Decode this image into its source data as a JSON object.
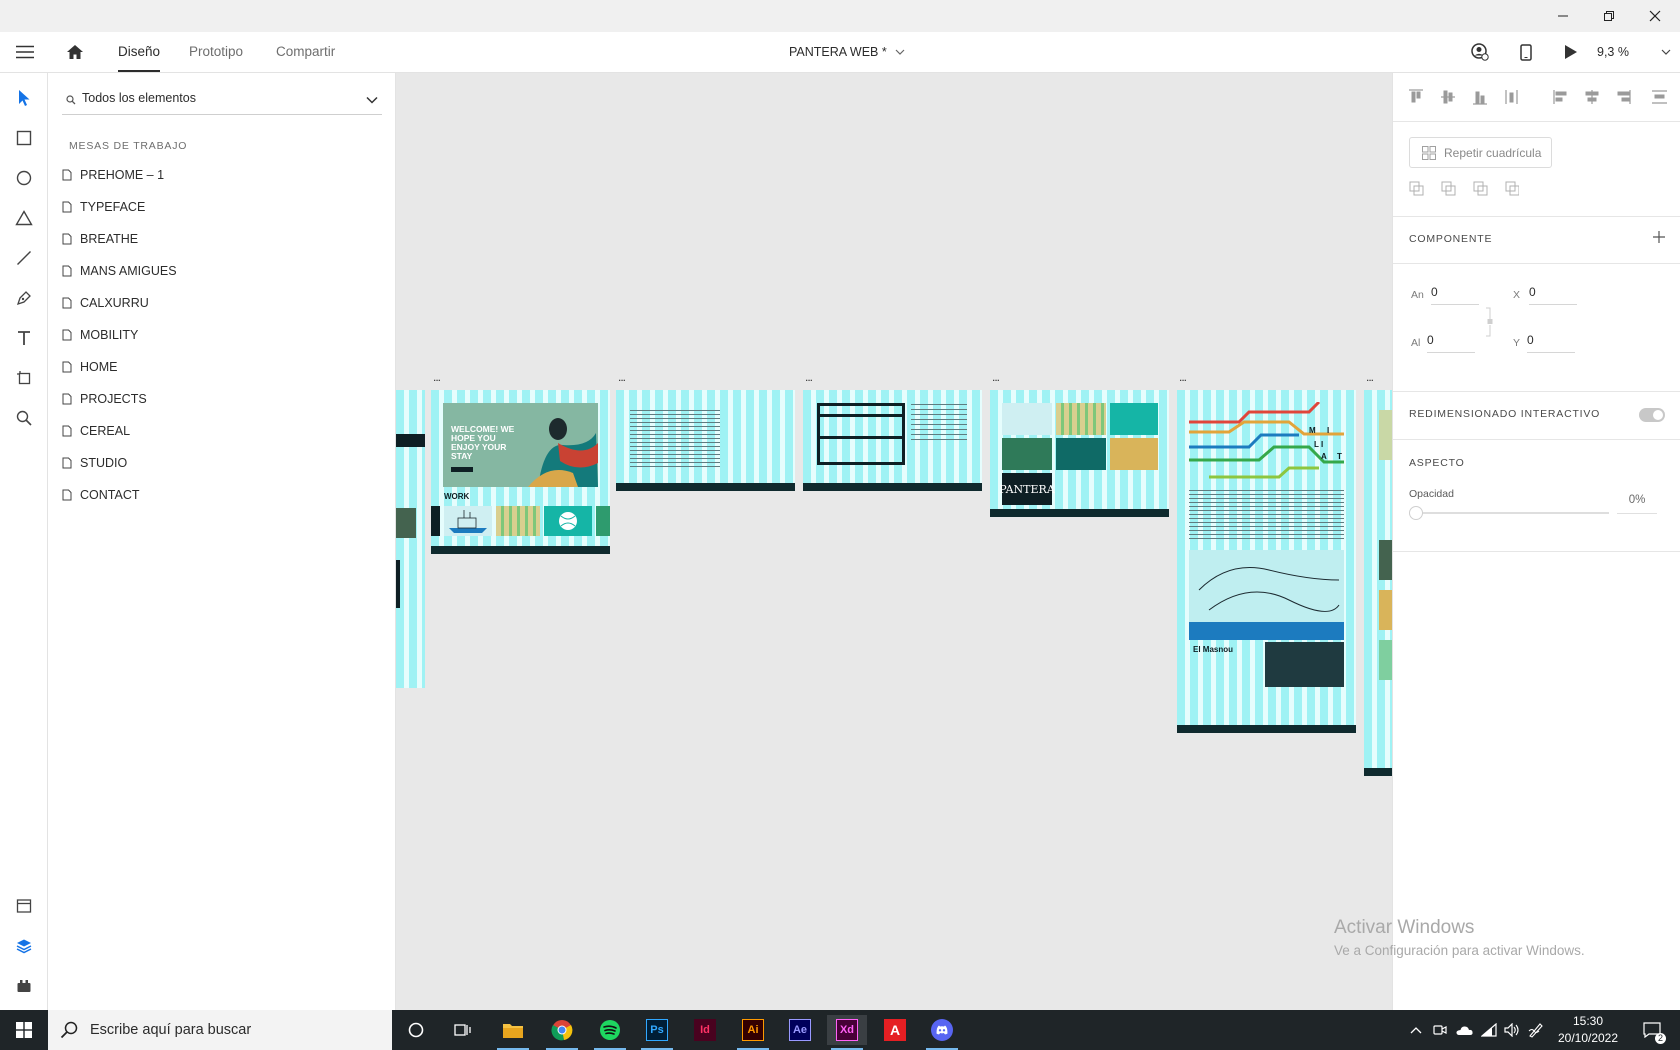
{
  "window": {
    "minimize": "—",
    "maximize": "❐",
    "close": "✕"
  },
  "header": {
    "tabs": [
      {
        "label": "Diseño",
        "active": true
      },
      {
        "label": "Prototipo",
        "active": false
      },
      {
        "label": "Compartir",
        "active": false
      }
    ],
    "document_title": "PANTERA WEB *",
    "zoom": "9,3 %"
  },
  "layers": {
    "search_placeholder": "Todos los elementos",
    "section_title": "MESAS DE TRABAJO",
    "artboards": [
      "PREHOME – 1",
      "TYPEFACE",
      "BREATHE",
      "MANS AMIGUES",
      "CALXURRU",
      "MOBILITY",
      "HOME",
      "PROJECTS",
      "CEREAL",
      "STUDIO",
      "CONTACT"
    ]
  },
  "canvas": {
    "artboard_menu": "...",
    "home_headline": "WELCOME! WE HOPE YOU ENJOY YOUR STAY",
    "home_section": "WORK",
    "brand": "PANTERA",
    "mobility_title": "El Masnou",
    "mobility_letters": [
      "M",
      "B",
      "I",
      "L",
      "I",
      "T",
      "A",
      "T"
    ]
  },
  "properties": {
    "repeat_grid": "Repetir cuadrícula",
    "component_title": "COMPONENTE",
    "width_label": "An",
    "height_label": "Al",
    "x_label": "X",
    "y_label": "Y",
    "width_value": "0",
    "height_value": "0",
    "x_value": "0",
    "y_value": "0",
    "responsive_title": "REDIMENSIONADO INTERACTIVO",
    "appearance_title": "ASPECTO",
    "opacity_label": "Opacidad",
    "opacity_value": "0%"
  },
  "watermark": {
    "line1": "Activar Windows",
    "line2": "Ve a Configuración para activar Windows."
  },
  "taskbar": {
    "search_placeholder": "Escribe aquí para buscar",
    "apps": [
      "file-explorer",
      "chrome",
      "spotify",
      "photoshop",
      "indesign",
      "illustrator",
      "after-effects",
      "adobe-xd",
      "autocad",
      "discord"
    ],
    "app_labels": {
      "ps": "Ps",
      "id": "Id",
      "ai": "Ai",
      "ae": "Ae",
      "xd": "Xd",
      "autocad": "A"
    },
    "time": "15:30",
    "date": "20/10/2022",
    "notifications": "2"
  }
}
